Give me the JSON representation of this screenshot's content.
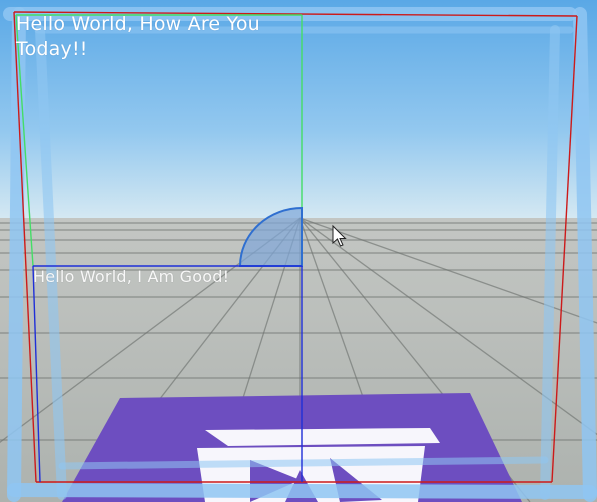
{
  "labels": {
    "top_text": "Hello World, How Are You Today!!",
    "bottom_text": "Hello World, I Am Good!"
  },
  "colors": {
    "sky_top": "#5aa8e6",
    "sky_bottom": "#c9e3f2",
    "ground": "#b3b8b4",
    "grid_line": "#6e726f",
    "frame_glow": "#8fc6f2",
    "outer_frame": "#cc1a1a",
    "green_frame": "#44dd66",
    "blue_frame": "#1f2fd8",
    "quarter_fill": "#7fa6d8",
    "quarter_stroke": "#2f6fd0",
    "floor_logo": "#6d4ec0",
    "floor_logo_mark": "#ffffff"
  },
  "icons": {
    "cursor": "mouse-pointer-icon",
    "floor_logo": "floor-logo-icon"
  }
}
